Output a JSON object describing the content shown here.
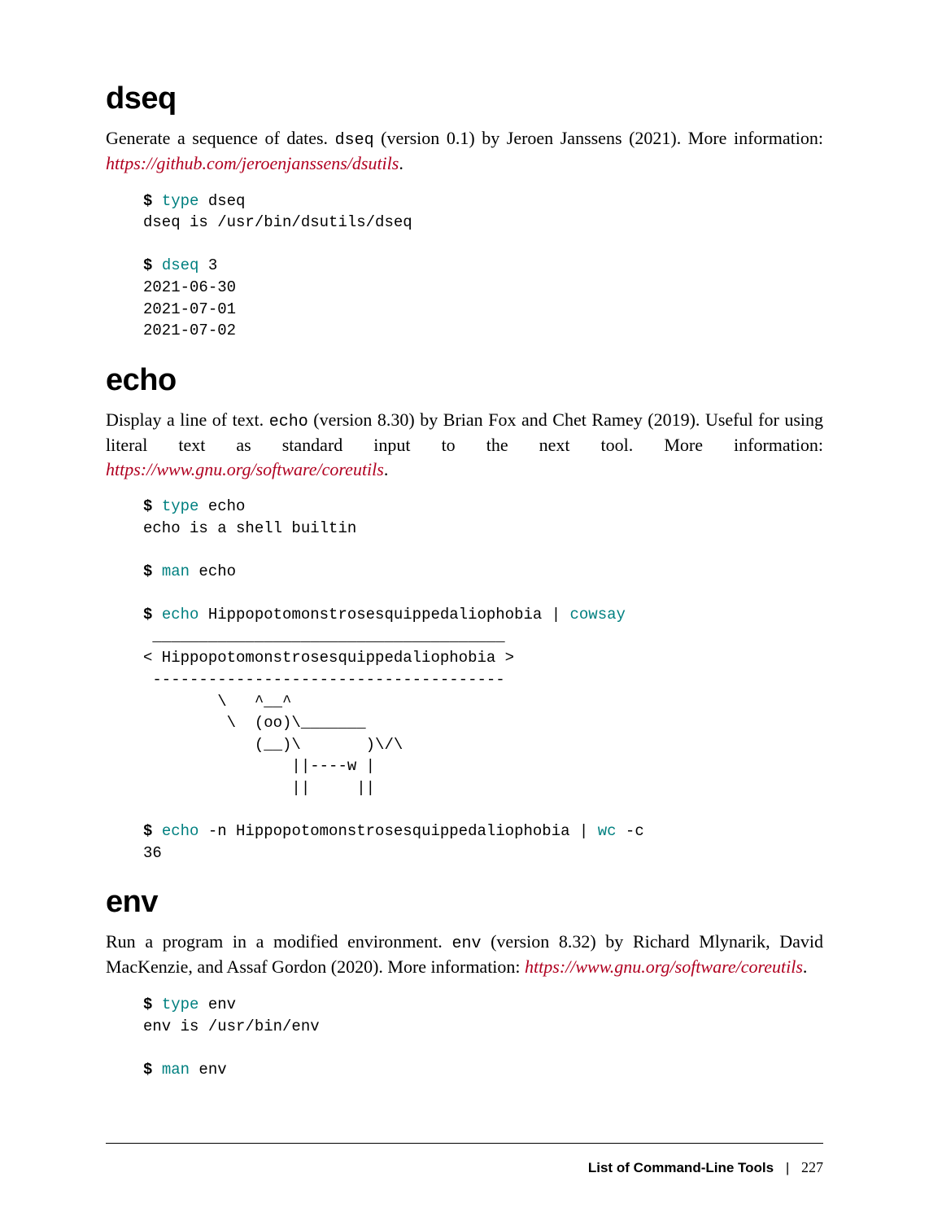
{
  "sections": {
    "dseq": {
      "heading": "dseq",
      "desc_pre": "Generate a sequence of dates. ",
      "code": "dseq",
      "desc_mid": " (version 0.1) by Jeroen Janssens (2021). More information: ",
      "link": "https://github.com/jeroenjanssens/dsutils",
      "desc_post": ".",
      "code1_prompt": "$ ",
      "code1_cmd": "type",
      "code1_rest": " dseq",
      "code1_out": "dseq is /usr/bin/dsutils/dseq",
      "code2_prompt": "$ ",
      "code2_cmd": "dseq",
      "code2_rest": " 3",
      "code2_out": "2021-06-30\n2021-07-01\n2021-07-02"
    },
    "echo": {
      "heading": "echo",
      "desc_pre": "Display a line of text. ",
      "code": "echo",
      "desc_mid": " (version 8.30) by Brian Fox and Chet Ramey (2019). Useful for using literal text as standard input to the next tool. More information: ",
      "link": "https://www.gnu.org/software/coreutils",
      "desc_post": ".",
      "code1_prompt": "$ ",
      "code1_cmd": "type",
      "code1_rest": " echo",
      "code1_out": "echo is a shell builtin",
      "code2_prompt": "$ ",
      "code2_cmd": "man",
      "code2_rest": " echo",
      "code3_prompt": "$ ",
      "code3_cmd": "echo",
      "code3_rest": " Hippopotomonstrosesquippedaliophobia | ",
      "code3_cmd2": "cowsay",
      "code3_out": " ______________________________________\n< Hippopotomonstrosesquippedaliophobia >\n --------------------------------------\n        \\   ^__^\n         \\  (oo)\\_______\n            (__)\\       )\\/\\\n                ||----w |\n                ||     ||",
      "code4_prompt": "$ ",
      "code4_cmd": "echo",
      "code4_rest": " -n Hippopotomonstrosesquippedaliophobia | ",
      "code4_cmd2": "wc",
      "code4_rest2": " -c",
      "code4_out": "36"
    },
    "env": {
      "heading": "env",
      "desc_pre": "Run a program in a modified environment. ",
      "code": "env",
      "desc_mid": " (version 8.32) by Richard Mlynarik, David MacKenzie, and Assaf Gordon (2020). More information: ",
      "link": "https://www.gnu.org/software/coreutils",
      "desc_post": ".",
      "code1_prompt": "$ ",
      "code1_cmd": "type",
      "code1_rest": " env",
      "code1_out": "env is /usr/bin/env",
      "code2_prompt": "$ ",
      "code2_cmd": "man",
      "code2_rest": " env"
    }
  },
  "footer": {
    "title": "List of Command-Line Tools",
    "sep": "|",
    "page": "227"
  }
}
